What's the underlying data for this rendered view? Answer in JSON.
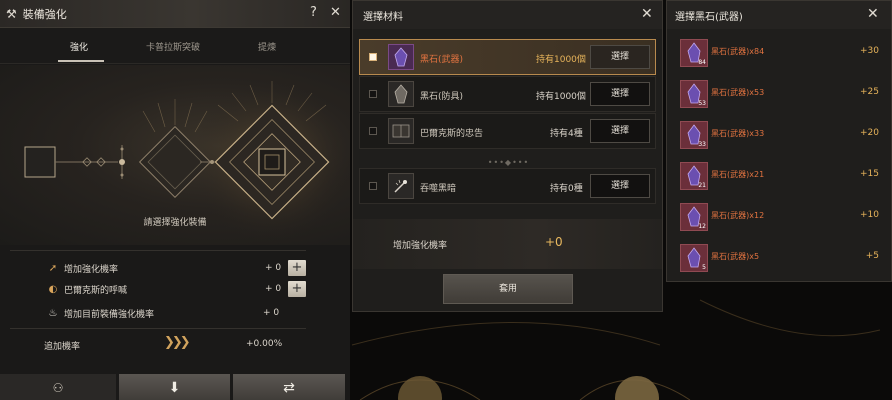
{
  "enhance": {
    "title": "裝備強化",
    "help": "?",
    "close": "✕",
    "tabs": [
      "強化",
      "卡普拉斯突破",
      "提煉"
    ],
    "hint": "請選擇強化裝備",
    "stats": [
      {
        "label": "增加強化機率",
        "value": "+ 0",
        "has_plus": true
      },
      {
        "label": "巴爾克斯的呼喊",
        "value": "+ 0",
        "has_plus": true
      },
      {
        "label": "增加目前裝備強化機率",
        "value": "+ 0",
        "has_plus": false
      }
    ],
    "bonus_label": "追加機率",
    "bonus_value": "+0.00%"
  },
  "material": {
    "title": "選擇材料",
    "close": "✕",
    "items": [
      {
        "name": "黑石(武器)",
        "own": "持有1000個",
        "button": "選擇"
      },
      {
        "name": "黑石(防具)",
        "own": "持有1000個",
        "button": "選擇"
      },
      {
        "name": "巴爾克斯的忠告",
        "own": "持有4種",
        "button": "選擇"
      },
      {
        "name": "吞噬黑暗",
        "own": "持有0種",
        "button": "選擇"
      }
    ],
    "rate_label": "增加強化機率",
    "rate_value": "+0",
    "apply": "套用"
  },
  "stones": {
    "title": "選擇黑石(武器)",
    "close": "✕",
    "rows": [
      {
        "name": "黑石(武器)x84",
        "count": "84",
        "value": "+30"
      },
      {
        "name": "黑石(武器)x53",
        "count": "53",
        "value": "+25"
      },
      {
        "name": "黑石(武器)x33",
        "count": "33",
        "value": "+20"
      },
      {
        "name": "黑石(武器)x21",
        "count": "21",
        "value": "+15"
      },
      {
        "name": "黑石(武器)x12",
        "count": "12",
        "value": "+10"
      },
      {
        "name": "黑石(武器)x5",
        "count": "5",
        "value": "+5"
      }
    ]
  },
  "colors": {
    "accent_gold": "#e6b35a",
    "item_orange": "#e27340",
    "panel_bg": "#1f1e1c"
  }
}
